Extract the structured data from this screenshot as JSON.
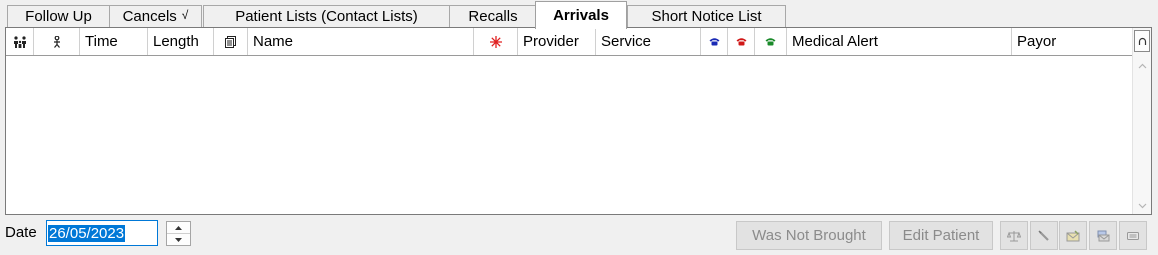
{
  "tabs": [
    {
      "label": "Follow Up"
    },
    {
      "label": "Cancels",
      "mark": "√"
    },
    {
      "label": "Patient Lists (Contact Lists)"
    },
    {
      "label": "Recalls"
    },
    {
      "label": "Arrivals",
      "active": true
    },
    {
      "label": "Short Notice List"
    }
  ],
  "columns": {
    "family_icon": "family-icon",
    "person_icon": "person-icon",
    "time": "Time",
    "length": "Length",
    "notes_icon": "notes-icon",
    "name": "Name",
    "alert_icon": "red-star-icon",
    "provider": "Provider",
    "service": "Service",
    "phone_blue_icon": "phone-icon-blue",
    "phone_red_icon": "phone-icon-red",
    "phone_green_icon": "phone-icon-green",
    "medical_alert": "Medical Alert",
    "payor": "Payor"
  },
  "rows": [],
  "footer": {
    "date_label": "Date",
    "date_value": "26/05/2023",
    "was_not_brought_label": "Was Not Brought",
    "edit_patient_label": "Edit Patient",
    "icon_buttons": [
      "scales-icon",
      "pen-icon",
      "mail-icon",
      "envelope-icon",
      "keyboard-icon"
    ]
  },
  "colors": {
    "selection": "#0078d7",
    "disabled_text": "#8b8b8b",
    "phone_blue": "#1a2ab5",
    "phone_red": "#d01818",
    "phone_green": "#1a8a2a",
    "star_red": "#e02020"
  }
}
